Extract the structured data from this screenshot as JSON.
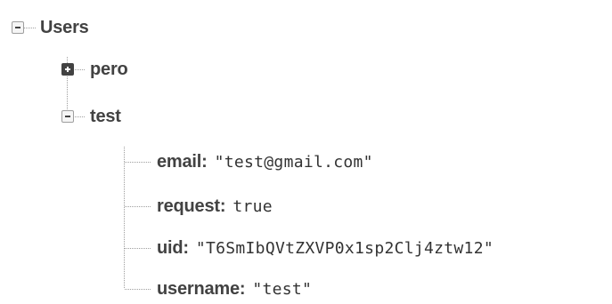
{
  "tree": {
    "root": {
      "key": "Users",
      "expanded": true,
      "children": [
        {
          "key": "pero",
          "expanded": false
        },
        {
          "key": "test",
          "expanded": true,
          "fields": [
            {
              "key": "email:",
              "value": "\"test@gmail.com\""
            },
            {
              "key": "request:",
              "value": "true"
            },
            {
              "key": "uid:",
              "value": "\"T6SmIbQVtZXVP0x1sp2Clj4ztw12\""
            },
            {
              "key": "username:",
              "value": "\"test\""
            }
          ]
        }
      ]
    }
  },
  "colors": {
    "guide_line": "#9e9e9e",
    "key_text": "#424242",
    "value_text": "#333333"
  }
}
